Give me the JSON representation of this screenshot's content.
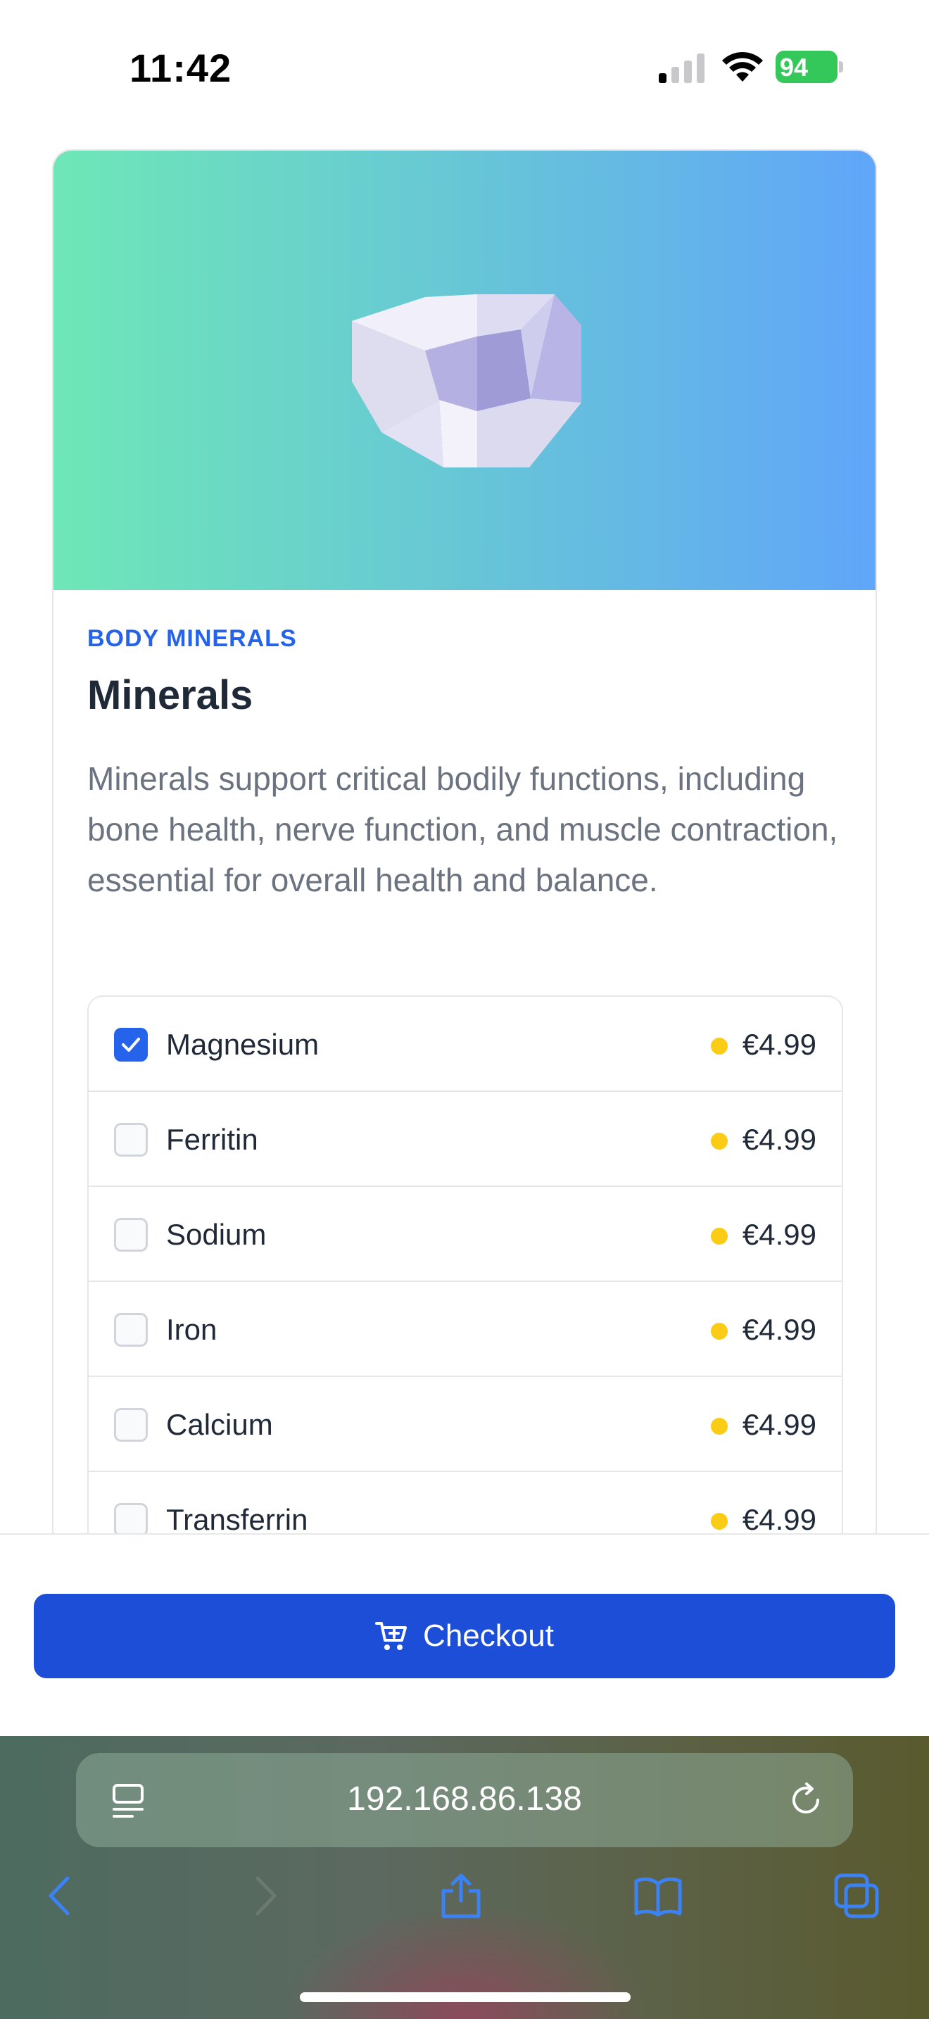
{
  "status_bar": {
    "time": "11:42",
    "battery_level": "94",
    "icons": [
      "signal-icon",
      "wifi-icon",
      "battery-charging-icon"
    ]
  },
  "product": {
    "category": "BODY MINERALS",
    "title": "Minerals",
    "description": "Minerals support critical bodily functions, including bone health, nerve function, and muscle contraction, essential for overall health and balance.",
    "hero_gradient": [
      "#6ee7b7",
      "#60a5fa"
    ],
    "items": [
      {
        "name": "Magnesium",
        "price": "€4.99",
        "checked": true
      },
      {
        "name": "Ferritin",
        "price": "€4.99",
        "checked": false
      },
      {
        "name": "Sodium",
        "price": "€4.99",
        "checked": false
      },
      {
        "name": "Iron",
        "price": "€4.99",
        "checked": false
      },
      {
        "name": "Calcium",
        "price": "€4.99",
        "checked": false
      },
      {
        "name": "Transferrin",
        "price": "€4.99",
        "checked": false
      }
    ]
  },
  "checkout": {
    "label": "Checkout",
    "color": "#1d4ed8"
  },
  "browser": {
    "url": "192.168.86.138",
    "toolbar_icons": [
      "back-icon",
      "forward-icon",
      "share-icon",
      "bookmarks-icon",
      "tabs-icon"
    ]
  },
  "colors": {
    "accent": "#2563eb",
    "price_dot": "#facc15"
  }
}
